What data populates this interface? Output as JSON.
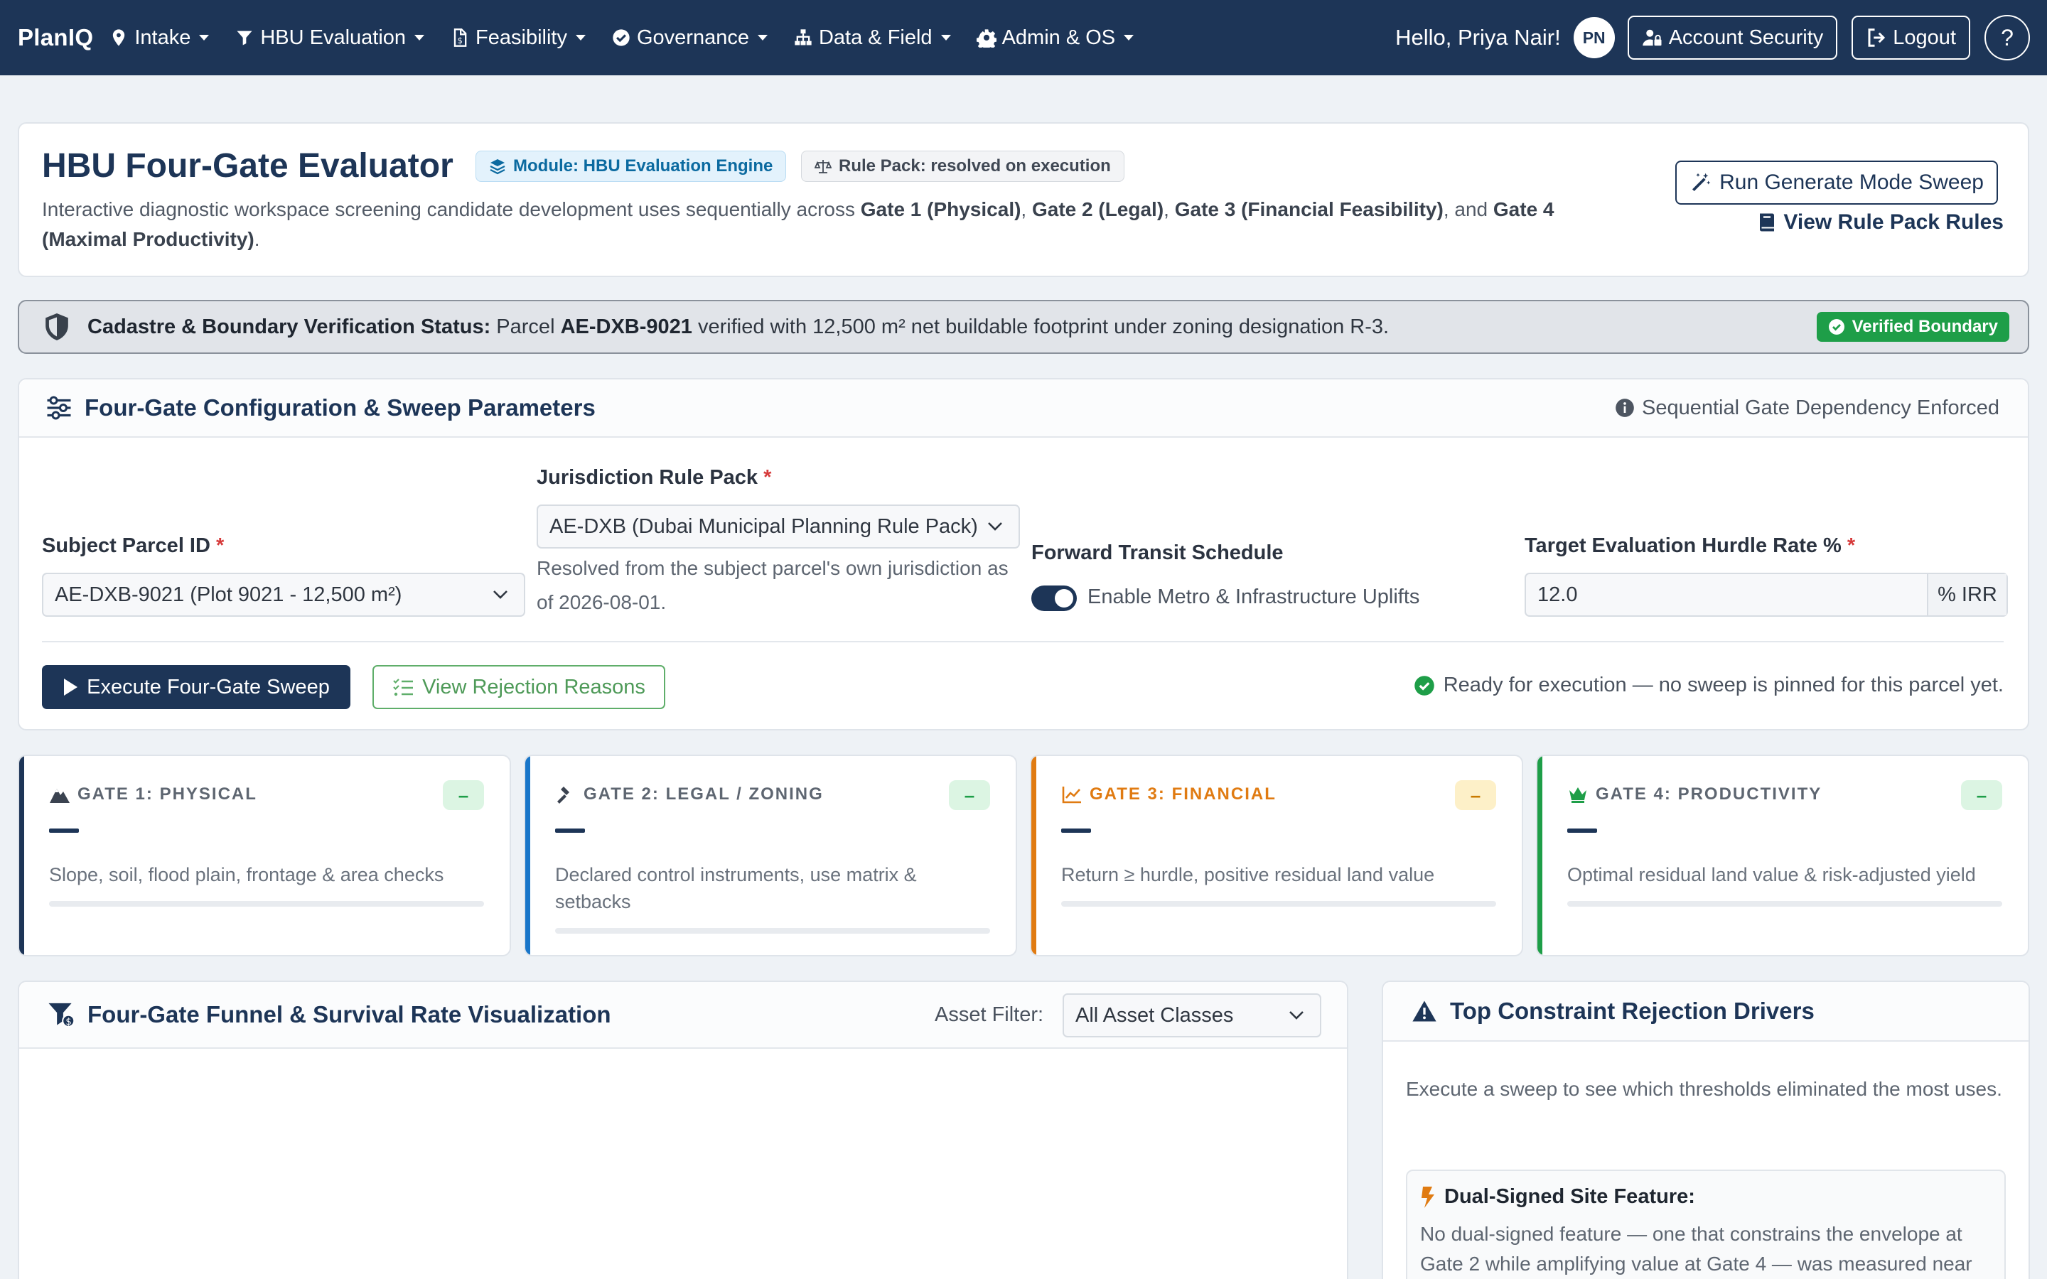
{
  "nav": {
    "brand": "PlanIQ",
    "items": [
      {
        "label": "Intake",
        "icon": "map-pin-icon"
      },
      {
        "label": "HBU Evaluation",
        "icon": "filter-icon"
      },
      {
        "label": "Feasibility",
        "icon": "file-dollar-icon"
      },
      {
        "label": "Governance",
        "icon": "check-circle-icon"
      },
      {
        "label": "Data & Field",
        "icon": "sitemap-icon"
      },
      {
        "label": "Admin & OS",
        "icon": "gear-icon"
      }
    ],
    "greeting": "Hello, Priya Nair!",
    "avatar_initials": "PN",
    "account_security": "Account Security",
    "logout": "Logout",
    "help": "?"
  },
  "header": {
    "title": "HBU Four-Gate Evaluator",
    "module_badge": "Module: HBU Evaluation Engine",
    "rule_badge": "Rule Pack: resolved on execution",
    "desc_prefix": "Interactive diagnostic workspace screening candidate development uses sequentially across ",
    "gate1": "Gate 1 (Physical)",
    "gate2": "Gate 2 (Legal)",
    "gate3": "Gate 3 (Financial Feasibility)",
    "gate4": "Gate 4 (Maximal Productivity)",
    "sep1": ", ",
    "sep2": ", ",
    "sep3": ", and ",
    "end": ".",
    "run_button": "Run Generate Mode Sweep",
    "rule_link": "View Rule Pack Rules"
  },
  "alert": {
    "label": "Cadastre & Boundary Verification Status:",
    "pre": " Parcel ",
    "parcel": "AE-DXB-9021",
    "post": " verified with 12,500 m² net buildable footprint under zoning designation R-3.",
    "badge": "Verified Boundary"
  },
  "config": {
    "title": "Four-Gate Configuration & Sweep Parameters",
    "note": "Sequential Gate Dependency Enforced",
    "parcel_label": "Subject Parcel ID",
    "parcel_value": "AE-DXB-9021 (Plot 9021 - 12,500 m²)",
    "rulepack_label": "Jurisdiction Rule Pack",
    "rulepack_value": "AE-DXB (Dubai Municipal Planning Rule Pack)",
    "rulepack_help": "Resolved from the subject parcel's own jurisdiction as of 2026-08-01.",
    "transit_label": "Forward Transit Schedule",
    "transit_toggle": "Enable Metro & Infrastructure Uplifts",
    "transit_enabled": true,
    "hurdle_label": "Target Evaluation Hurdle Rate %",
    "hurdle_value": "12.0",
    "hurdle_unit": "% IRR",
    "required_mark": "*",
    "execute_button": "Execute Four-Gate Sweep",
    "rejection_button": "View Rejection Reasons",
    "ready_text": "Ready for execution — no sweep is pinned for this parcel yet."
  },
  "gates": [
    {
      "title": "GATE 1: PHYSICAL",
      "pill": "–",
      "desc": "Slope, soil, flood plain, frontage & area checks",
      "accent": "#1d3557",
      "pill_bg": "#dcf5e3",
      "pill_color": "#1e9e48",
      "icon": "mountain-icon"
    },
    {
      "title": "GATE 2: LEGAL / ZONING",
      "pill": "–",
      "desc": "Declared control instruments, use matrix & setbacks",
      "accent": "#1976c9",
      "pill_bg": "#dcf5e3",
      "pill_color": "#1e9e48",
      "icon": "gavel-icon"
    },
    {
      "title": "GATE 3: FINANCIAL",
      "pill": "–",
      "desc": "Return ≥ hurdle, positive residual land value",
      "accent": "#e07b12",
      "pill_bg": "#fdf0c8",
      "pill_color": "#c97a00",
      "icon": "chart-line-icon"
    },
    {
      "title": "GATE 4: PRODUCTIVITY",
      "pill": "–",
      "desc": "Optimal residual land value & risk-adjusted yield",
      "accent": "#1e9e48",
      "pill_bg": "#dcf5e3",
      "pill_color": "#1e9e48",
      "icon": "crown-icon"
    }
  ],
  "funnel": {
    "title": "Four-Gate Funnel & Survival Rate Visualization",
    "filter_label": "Asset Filter:",
    "filter_value": "All Asset Classes"
  },
  "drivers": {
    "title": "Top Constraint Rejection Drivers",
    "empty": "Execute a sweep to see which thresholds eliminated the most uses.",
    "dual_title": "Dual-Signed Site Feature:",
    "dual_body": "No dual-signed feature — one that constrains the envelope at Gate 2 while amplifying value at Gate 4 — was measured near"
  }
}
